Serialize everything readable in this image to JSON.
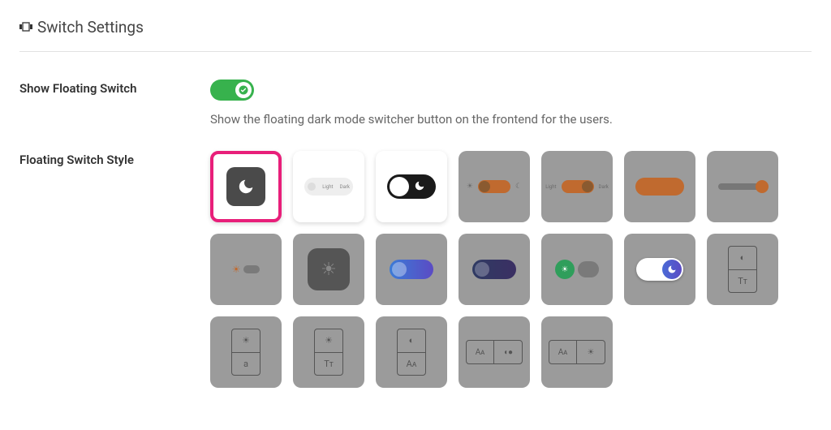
{
  "heading": {
    "title": "Switch Settings"
  },
  "show_floating": {
    "label": "Show Floating Switch",
    "enabled": true,
    "description": "Show the floating dark mode switcher button on the frontend for the users."
  },
  "floating_style": {
    "label": "Floating Switch Style",
    "selected": 0,
    "options": [
      {
        "id": "style-1-moon-square"
      },
      {
        "id": "style-2-light-dark-pill",
        "light_label": "Light",
        "dark_label": "Dark"
      },
      {
        "id": "style-3-bw-moon-toggle"
      },
      {
        "id": "style-4-orange-toggle-icons"
      },
      {
        "id": "style-5-orange-toggle-labeled",
        "left_label": "Light",
        "right_label": "Dark"
      },
      {
        "id": "style-6-orange-bar"
      },
      {
        "id": "style-7-orange-slider"
      },
      {
        "id": "style-8-sun-mini-toggle"
      },
      {
        "id": "style-9-sun-square"
      },
      {
        "id": "style-10-blue-gradient-pill"
      },
      {
        "id": "style-11-dark-gradient-pill"
      },
      {
        "id": "style-12-green-sun"
      },
      {
        "id": "style-13-white-moon-toggle"
      },
      {
        "id": "style-14-stack-contrast-text"
      },
      {
        "id": "style-15-stack-sun-a"
      },
      {
        "id": "style-16-stack-sun-tt"
      },
      {
        "id": "style-17-stack-contrast-aa"
      },
      {
        "id": "style-18-pair-aa-toggle"
      },
      {
        "id": "style-19-pair-aa-sun"
      }
    ]
  },
  "colors": {
    "accent_green": "#37b24d",
    "accent_pink": "#e81f7a",
    "accent_orange": "#c06a2f"
  }
}
